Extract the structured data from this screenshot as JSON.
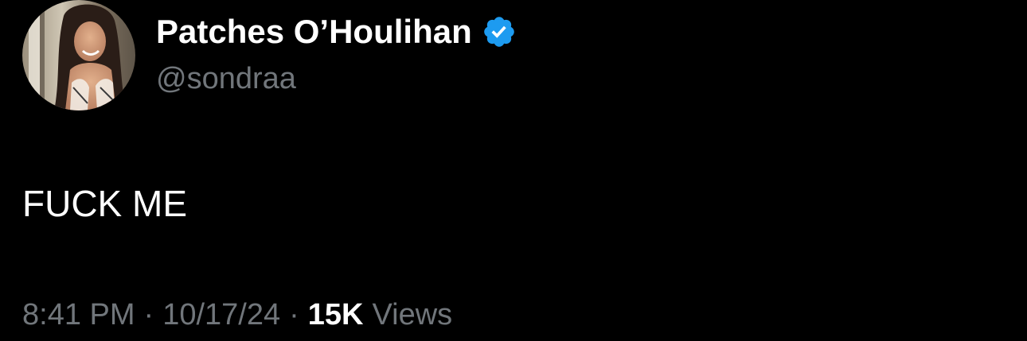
{
  "author": {
    "display_name": "Patches O’Houlihan",
    "handle": "@sondraa",
    "verified": true,
    "verified_icon": "verified-badge-icon",
    "avatar_icon": "profile-avatar"
  },
  "tweet": {
    "text": "FUCK ME"
  },
  "meta": {
    "time": "8:41 PM",
    "separator": "·",
    "date": "10/17/24",
    "views_count": "15K",
    "views_label": "Views"
  },
  "colors": {
    "background": "#000000",
    "text_primary": "#ffffff",
    "text_secondary": "#71767b",
    "verified_blue": "#1d9bf0"
  }
}
